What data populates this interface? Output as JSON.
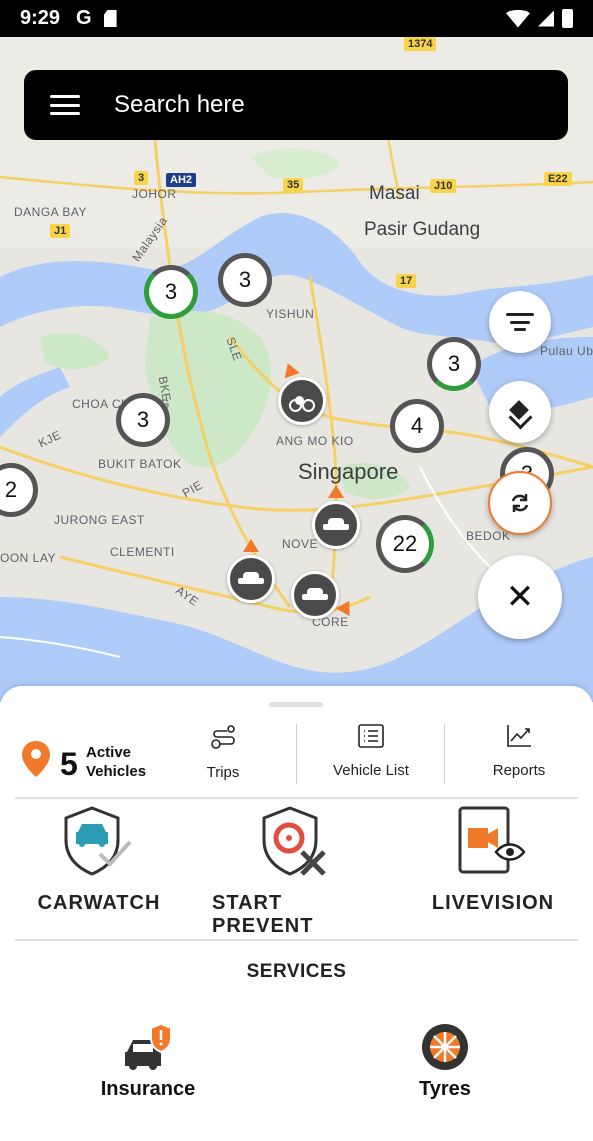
{
  "status_bar": {
    "time": "9:29",
    "g_label": "G"
  },
  "search": {
    "placeholder": "Search here"
  },
  "map": {
    "place_labels": [
      {
        "key": "johor",
        "text": "JOHOR"
      },
      {
        "key": "masai",
        "text": "Masai"
      },
      {
        "key": "pasir_gudang",
        "text": "Pasir Gudang"
      },
      {
        "key": "danga_bay",
        "text": "DANGA BAY"
      },
      {
        "key": "malaysia",
        "text": "Malaysia"
      },
      {
        "key": "yishun",
        "text": "YISHUN"
      },
      {
        "key": "pulau_ubin",
        "text": "Pulau Ubin"
      },
      {
        "key": "choa_chu_kang",
        "text": "CHOA CH KANG"
      },
      {
        "key": "ang_mo_kio",
        "text": "ANG MO KIO"
      },
      {
        "key": "singapore",
        "text": "Singapore"
      },
      {
        "key": "bukit_batok",
        "text": "BUKIT BATOK"
      },
      {
        "key": "jurong_east",
        "text": "JURONG EAST"
      },
      {
        "key": "clementi",
        "text": "CLEMENTI"
      },
      {
        "key": "boon_lay",
        "text": "OON LAY"
      },
      {
        "key": "bedok",
        "text": "BEDOK"
      },
      {
        "key": "novena",
        "text": "NOVE"
      },
      {
        "key": "core",
        "text": "CORE"
      },
      {
        "key": "kje",
        "text": "KJE"
      },
      {
        "key": "pie",
        "text": "PIE"
      },
      {
        "key": "aye",
        "text": "AYE"
      },
      {
        "key": "bke",
        "text": "BKE"
      },
      {
        "key": "sle",
        "text": "SLE"
      }
    ],
    "road_shields": [
      {
        "text": "3",
        "blue": false
      },
      {
        "text": "AH2",
        "blue": true
      },
      {
        "text": "35",
        "blue": false
      },
      {
        "text": "J10",
        "blue": false
      },
      {
        "text": "E22",
        "blue": false
      },
      {
        "text": "J1",
        "blue": false
      },
      {
        "text": "17",
        "blue": false
      },
      {
        "text": "1374",
        "blue": false
      }
    ],
    "clusters": [
      {
        "count": "3",
        "ring_color": "#2e9d3a",
        "ring_fraction": 0.6
      },
      {
        "count": "3",
        "ring_color": "#555555",
        "ring_fraction": 0
      },
      {
        "count": "3",
        "ring_color": "#2e9d3a",
        "ring_fraction": 0.25
      },
      {
        "count": "3",
        "ring_color": "#555555",
        "ring_fraction": 0
      },
      {
        "count": "4",
        "ring_color": "#555555",
        "ring_fraction": 0
      },
      {
        "count": "2",
        "ring_color": "#555555",
        "ring_fraction": 0
      },
      {
        "count": "3",
        "ring_color": "#555555",
        "ring_fraction": 0
      },
      {
        "count": "22",
        "ring_color": "#2e9d3a",
        "ring_fraction": 0.05
      }
    ]
  },
  "fabs": {
    "close_glyph": "✕"
  },
  "sheet": {
    "active_count": "5",
    "active_label": "Active Vehicles",
    "trips_label": "Trips",
    "vehicle_list_label": "Vehicle List",
    "reports_label": "Reports",
    "features": {
      "carwatch": "CARWATCH",
      "start_prevent": "START PREVENT",
      "livevision": "LIVEVISION"
    },
    "services_title": "SERVICES",
    "services": {
      "insurance": "Insurance",
      "tyres": "Tyres"
    }
  },
  "colors": {
    "accent": "#f07a2a",
    "teal": "#2a9db5",
    "green_ring": "#2e9d3a",
    "water": "#aecbfa",
    "land": "#e8e6e1",
    "park": "#cce8c6"
  }
}
